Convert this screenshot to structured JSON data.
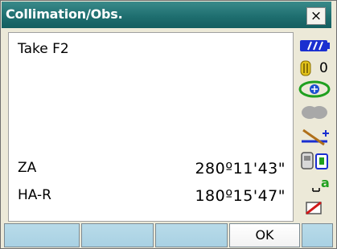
{
  "window": {
    "title": "Collimation/Obs.",
    "close_glyph": "×"
  },
  "content": {
    "message": "Take F2",
    "rows": [
      {
        "label": "ZA",
        "value": "280º11'43\""
      },
      {
        "label": "HA-R",
        "value": "180º15'47\""
      }
    ]
  },
  "status_icons": {
    "battery": {
      "icon": "battery-icon",
      "color": "#1a2fd0"
    },
    "prism": {
      "icon": "prism-icon",
      "value": "0"
    },
    "tilt": {
      "icon": "tilt-compensation-icon",
      "color": "#1fa01f"
    },
    "laser": {
      "icon": "laser-pointer-icon",
      "color": "#a8a8a8"
    },
    "bluetooth": {
      "icon": "instrument-connection-icon"
    },
    "comm": {
      "icon": "communication-icon"
    },
    "input_mode": {
      "icon": "input-mode-icon",
      "text": "a"
    },
    "memory": {
      "icon": "memory-card-icon"
    }
  },
  "function_keys": [
    {
      "label": ""
    },
    {
      "label": ""
    },
    {
      "label": ""
    },
    {
      "label": "OK"
    },
    {
      "label": ""
    }
  ],
  "colors": {
    "title_bar": "#1f6f70",
    "function_key": "#aed4e6",
    "ok_key": "#ffffff"
  }
}
